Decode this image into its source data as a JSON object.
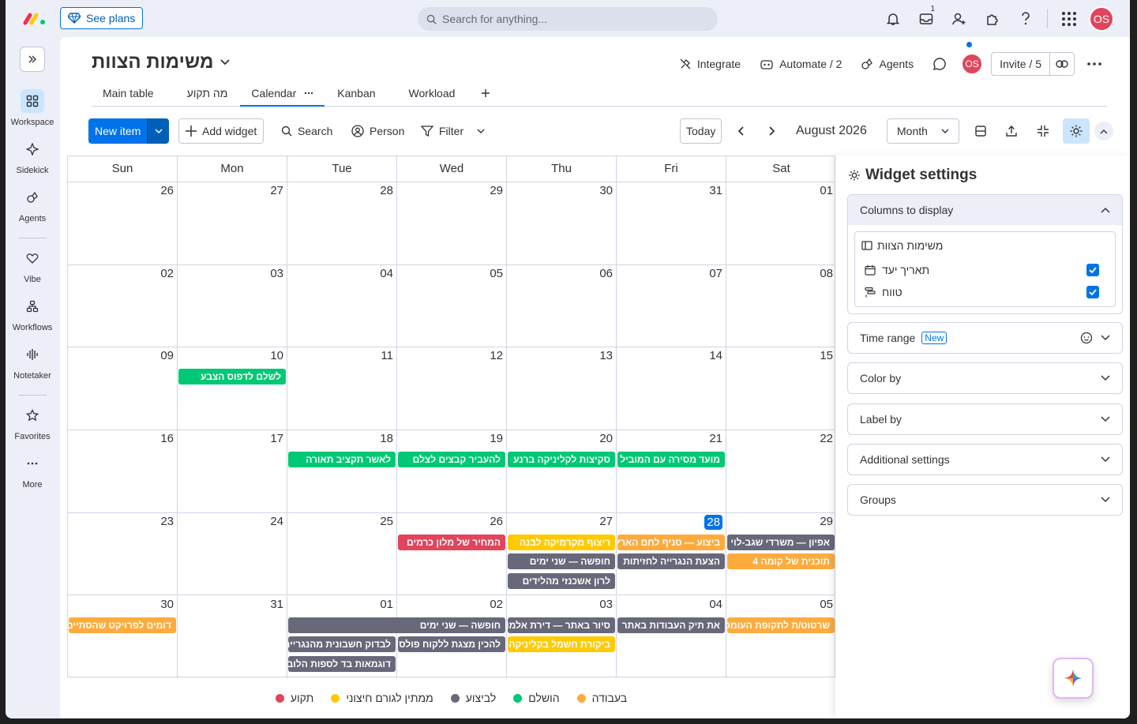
{
  "topbar": {
    "see_plans": "See plans",
    "search_placeholder": "Search for anything...",
    "inbox_count": "1",
    "avatar_initials": "OS"
  },
  "rail": {
    "items": [
      {
        "label": "Workspace",
        "icon": "grid-icon"
      },
      {
        "label": "Sidekick",
        "icon": "sparkle-icon"
      },
      {
        "label": "Agents",
        "icon": "agents-icon"
      },
      {
        "label": "Vibe",
        "icon": "heart-icon"
      },
      {
        "label": "Workflows",
        "icon": "workflows-icon"
      },
      {
        "label": "Notetaker",
        "icon": "waveform-icon"
      },
      {
        "label": "Favorites",
        "icon": "star-icon"
      },
      {
        "label": "More",
        "icon": "more-icon"
      }
    ]
  },
  "board": {
    "title": "משימות הצוות",
    "integrate": "Integrate",
    "automate": "Automate / 2",
    "agents": "Agents",
    "invite": "Invite / 5",
    "avatar_initials": "OS"
  },
  "tabs": [
    {
      "label": "Main table"
    },
    {
      "label": "מה תקוע"
    },
    {
      "label": "Calendar"
    },
    {
      "label": "Kanban"
    },
    {
      "label": "Workload"
    }
  ],
  "toolbar": {
    "new_item": "New item",
    "add_widget": "Add widget",
    "search": "Search",
    "person": "Person",
    "filter": "Filter",
    "today": "Today",
    "month_label": "August 2026",
    "view_select": "Month"
  },
  "calendar": {
    "weekdays": [
      "Sun",
      "Mon",
      "Tue",
      "Wed",
      "Thu",
      "Fri",
      "Sat"
    ],
    "weeks": [
      [
        "26",
        "27",
        "28",
        "29",
        "30",
        "31",
        "01"
      ],
      [
        "02",
        "03",
        "04",
        "05",
        "06",
        "07",
        "08"
      ],
      [
        "09",
        "10",
        "11",
        "12",
        "13",
        "14",
        "15"
      ],
      [
        "16",
        "17",
        "18",
        "19",
        "20",
        "21",
        "22"
      ],
      [
        "23",
        "24",
        "25",
        "26",
        "27",
        "28",
        "29"
      ],
      [
        "30",
        "31",
        "01",
        "02",
        "03",
        "04",
        "05"
      ]
    ],
    "today": {
      "week": 4,
      "day": 5
    },
    "events": [
      {
        "week": 2,
        "day": 1,
        "span": 1,
        "row": 0,
        "status": "done",
        "text": "לשלם לדפוס הצבע"
      },
      {
        "week": 3,
        "day": 2,
        "span": 1,
        "row": 0,
        "status": "done",
        "text": "לאשר תקציב תאורה"
      },
      {
        "week": 3,
        "day": 3,
        "span": 1,
        "row": 0,
        "status": "done",
        "text": "להעביר קבצים לצלם"
      },
      {
        "week": 3,
        "day": 4,
        "span": 1,
        "row": 0,
        "status": "done",
        "text": "סקיצות לקליניקה ברנע"
      },
      {
        "week": 3,
        "day": 5,
        "span": 1,
        "row": 0,
        "status": "done",
        "text": "מועד מסירה עם המוביל"
      },
      {
        "week": 4,
        "day": 3,
        "span": 1,
        "row": 0,
        "status": "stuck",
        "text": "המחיר של מלון כרמים"
      },
      {
        "week": 4,
        "day": 4,
        "span": 1,
        "row": 0,
        "status": "waiting",
        "text": "ריצוף מקרמיקה לבנה"
      },
      {
        "week": 4,
        "day": 5,
        "span": 1,
        "row": 0,
        "status": "working",
        "text": "ביצוע — סניף לחם הארץ"
      },
      {
        "week": 4,
        "day": 6,
        "span": 1,
        "row": 0,
        "status": "inprogress",
        "text": "אפיון — משרדי שגב-לוי"
      },
      {
        "week": 4,
        "day": 4,
        "span": 1,
        "row": 1,
        "status": "inprogress",
        "text": "חופשה — שני ימים"
      },
      {
        "week": 4,
        "day": 5,
        "span": 1,
        "row": 1,
        "status": "inprogress",
        "text": "הצעת הנגרייה לחזיתות"
      },
      {
        "week": 4,
        "day": 6,
        "span": 1,
        "row": 1,
        "status": "working",
        "text": "תוכנית של קומה 4"
      },
      {
        "week": 4,
        "day": 4,
        "span": 1,
        "row": 2,
        "status": "inprogress",
        "text": "לרון אשכנזי מהלידים"
      },
      {
        "week": 5,
        "day": 0,
        "span": 1,
        "row": 0,
        "status": "working",
        "text": "דומים לפרויקט שהסתיים"
      },
      {
        "week": 5,
        "day": 2,
        "span": 2,
        "row": 0,
        "status": "inprogress",
        "text": "חופשה — שני ימים"
      },
      {
        "week": 5,
        "day": 4,
        "span": 1,
        "row": 0,
        "status": "inprogress",
        "text": "סיור באתר — דירת אלמוג"
      },
      {
        "week": 5,
        "day": 5,
        "span": 1,
        "row": 0,
        "status": "inprogress",
        "text": "את תיק העבודות באתר"
      },
      {
        "week": 5,
        "day": 6,
        "span": 1,
        "row": 0,
        "status": "working",
        "text": "שרטוט/ת לתקופת העומס"
      },
      {
        "week": 5,
        "day": 2,
        "span": 1,
        "row": 1,
        "status": "inprogress",
        "text": "לבדוק חשבונית מהנגרייה"
      },
      {
        "week": 5,
        "day": 3,
        "span": 1,
        "row": 1,
        "status": "inprogress",
        "text": "להכין מצגת ללקוח פולס"
      },
      {
        "week": 5,
        "day": 4,
        "span": 1,
        "row": 1,
        "status": "waiting",
        "text": "ביקורת חשמל בקליניקה"
      },
      {
        "week": 5,
        "day": 2,
        "span": 1,
        "row": 2,
        "status": "inprogress",
        "text": "דוגמאות בד לספות הלובי"
      }
    ],
    "legend": [
      {
        "status": "working",
        "label": "בעבודה"
      },
      {
        "status": "done",
        "label": "הושלם"
      },
      {
        "status": "inprogress",
        "label": "לביצוע"
      },
      {
        "status": "waiting",
        "label": "ממתין לגורם חיצוני"
      },
      {
        "status": "stuck",
        "label": "תקוע"
      }
    ],
    "colors": {
      "working": "#fdab3d",
      "done": "#00c875",
      "inprogress": "#676879",
      "waiting": "#ffcb00",
      "stuck": "#e2445c"
    }
  },
  "widget_settings": {
    "title": "Widget settings",
    "columns_to_display": "Columns to display",
    "group_column": "משימות הצוות",
    "columns": [
      {
        "label": "תאריך יעד",
        "icon": "calendar-icon",
        "checked": true
      },
      {
        "label": "טווח",
        "icon": "timeline-icon",
        "checked": true
      }
    ],
    "time_range": "Time range",
    "new_badge": "New",
    "color_by": "Color by",
    "label_by": "Label by",
    "additional_settings": "Additional settings",
    "groups": "Groups"
  }
}
